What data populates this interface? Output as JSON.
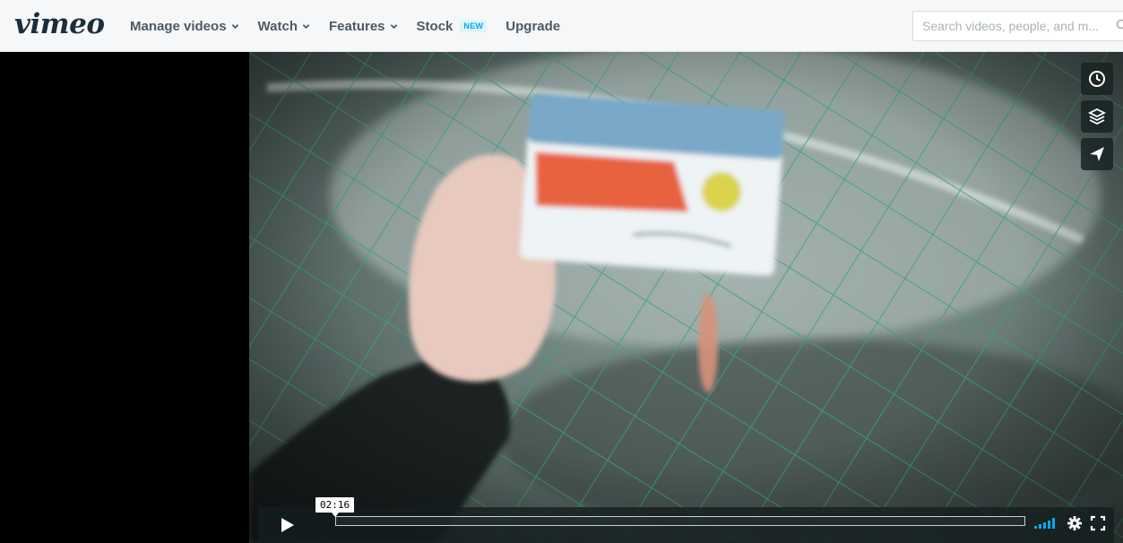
{
  "header": {
    "logo": "vimeo",
    "nav": [
      {
        "label": "Manage videos",
        "has_dropdown": true
      },
      {
        "label": "Watch",
        "has_dropdown": true
      },
      {
        "label": "Features",
        "has_dropdown": true
      },
      {
        "label": "Stock",
        "badge": "NEW",
        "has_dropdown": false
      },
      {
        "label": "Upgrade",
        "has_dropdown": false
      }
    ],
    "search": {
      "placeholder": "Search videos, people, and m..."
    }
  },
  "player": {
    "side_actions": [
      {
        "icon": "clock-icon",
        "action": "watch-later"
      },
      {
        "icon": "layers-icon",
        "action": "collections"
      },
      {
        "icon": "paper-plane-icon",
        "action": "share"
      }
    ],
    "controls": {
      "time_tooltip": "02:16",
      "progress_fraction": 0.0,
      "volume_level": 1.0
    }
  },
  "colors": {
    "accent": "#00adef",
    "nav_text": "#4b5a66",
    "logo": "#1a2e3b",
    "topbar_bg": "#f6f7f8",
    "control_bg": "rgba(20,30,30,0.80)"
  }
}
